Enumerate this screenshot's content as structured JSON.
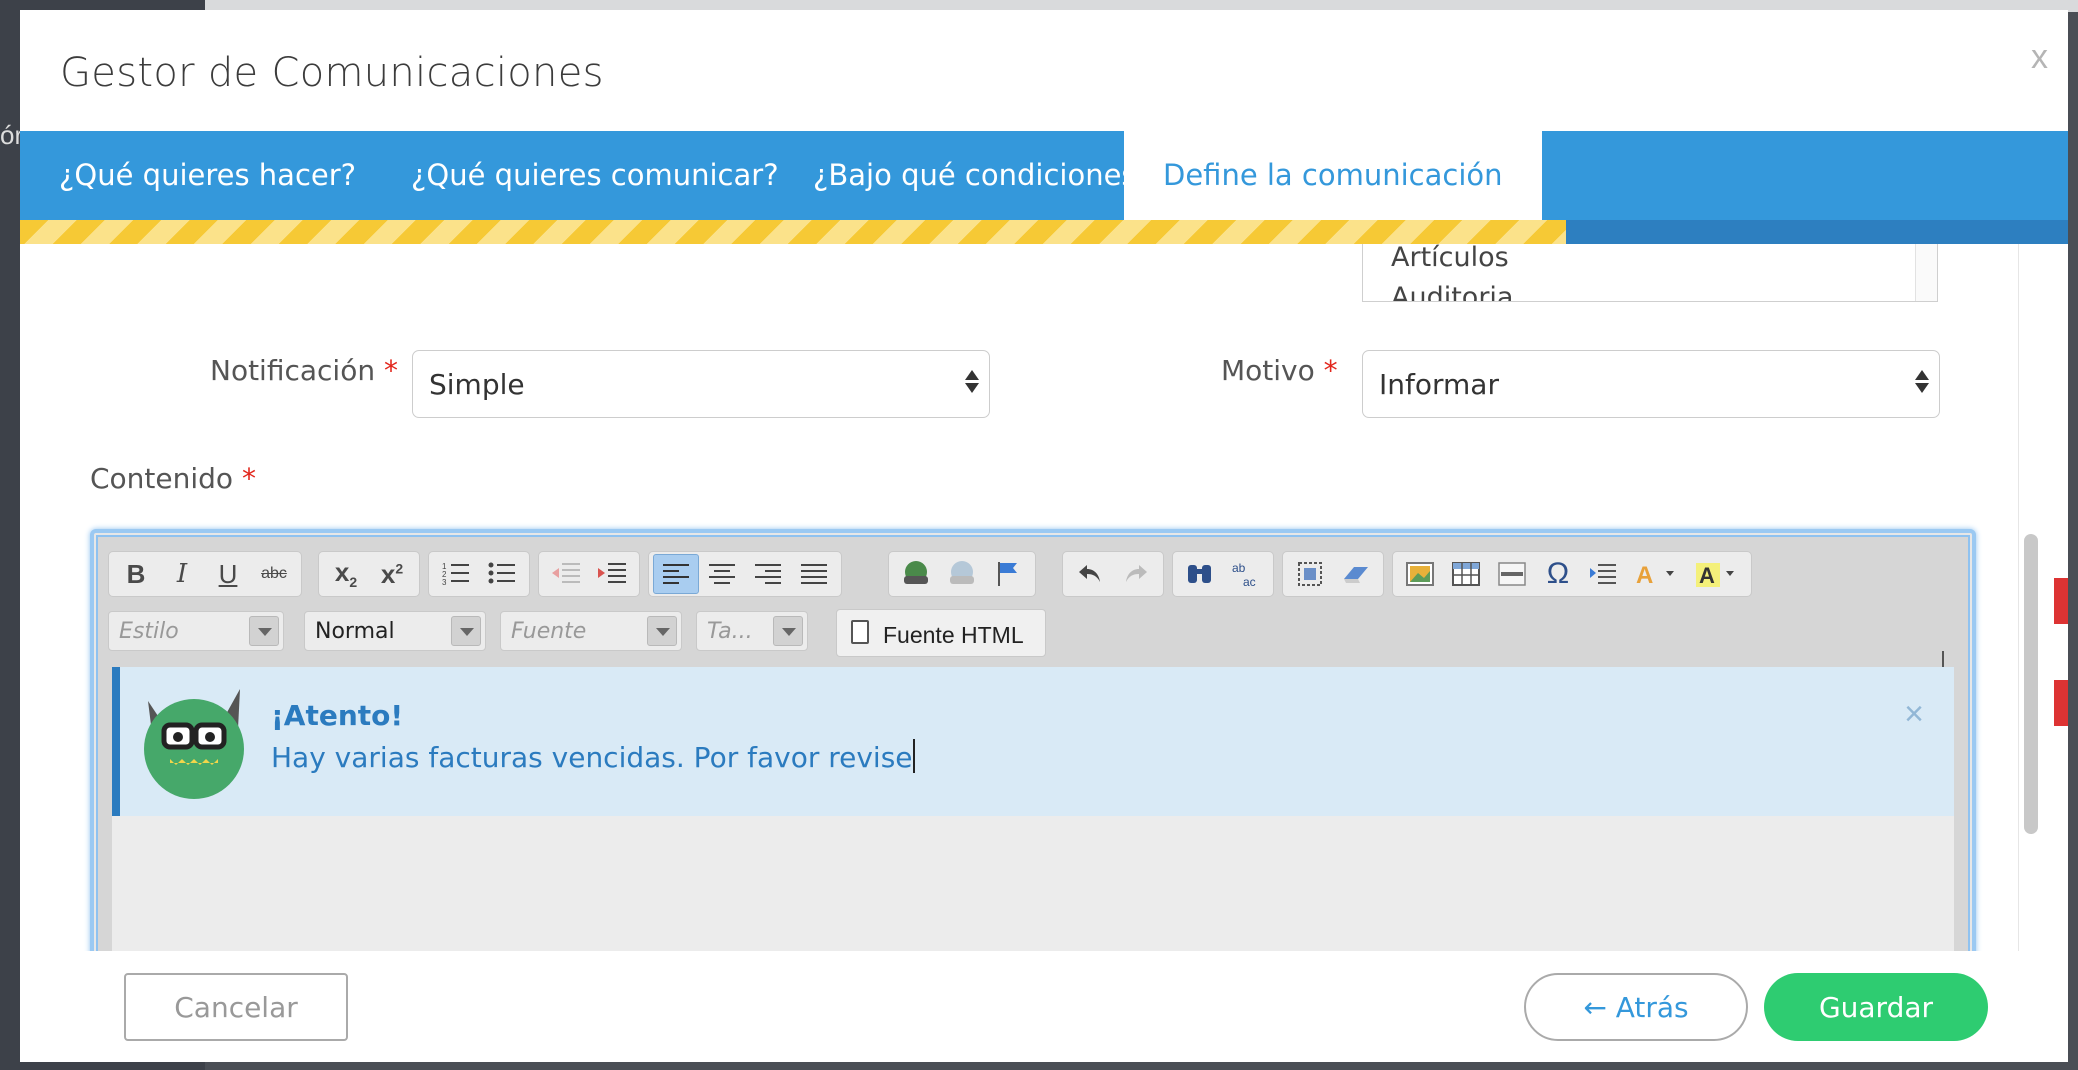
{
  "background": {
    "fragment": "ór"
  },
  "modal": {
    "title": "Gestor de Comunicaciones",
    "close_label": "x"
  },
  "tabs": [
    {
      "label": "¿Qué quieres hacer?"
    },
    {
      "label": "¿Qué quieres comunicar?"
    },
    {
      "label": "¿Bajo qué condiciones?"
    },
    {
      "label": "Define la comunicación",
      "active": true
    }
  ],
  "progress": {
    "fraction": 0.755
  },
  "listbox": {
    "items": [
      "Artículos",
      "Auditoria"
    ]
  },
  "form": {
    "notification_label": "Notificación",
    "notification_value": "Simple",
    "reason_label": "Motivo",
    "reason_value": "Informar",
    "content_label": "Contenido",
    "required_mark": "*"
  },
  "editor": {
    "combos": {
      "style": "Estilo",
      "format": "Normal",
      "font": "Fuente",
      "size": "Ta..."
    },
    "source_button": "Fuente HTML",
    "toolbar_icons": [
      [
        "bold-icon",
        "italic-icon",
        "underline-icon",
        "strikethrough-icon"
      ],
      [
        "subscript-icon",
        "superscript-icon"
      ],
      [
        "numbered-list-icon",
        "bulleted-list-icon"
      ],
      [
        "outdent-icon",
        "indent-icon"
      ],
      [
        "align-left-icon",
        "align-center-icon",
        "align-right-icon",
        "justify-icon"
      ],
      [
        "link-icon",
        "unlink-icon",
        "anchor-icon"
      ],
      [
        "undo-icon",
        "redo-icon"
      ],
      [
        "find-icon",
        "replace-icon"
      ],
      [
        "select-all-icon",
        "remove-format-icon"
      ],
      [
        "image-icon",
        "table-icon",
        "horizontal-rule-icon",
        "special-char-icon",
        "page-break-icon",
        "text-color-icon",
        "background-color-icon"
      ]
    ]
  },
  "alert": {
    "title": "¡Atento!",
    "text": "Hay varias facturas vencidas. Por favor revise",
    "close": "×"
  },
  "footer": {
    "cancel": "Cancelar",
    "back": "← Atrás",
    "save": "Guardar"
  },
  "colors": {
    "tabbar": "#3498db",
    "progress": "#f6c935",
    "save": "#2ecc71",
    "alert_text": "#2b7bbf",
    "required": "#e2261c"
  }
}
